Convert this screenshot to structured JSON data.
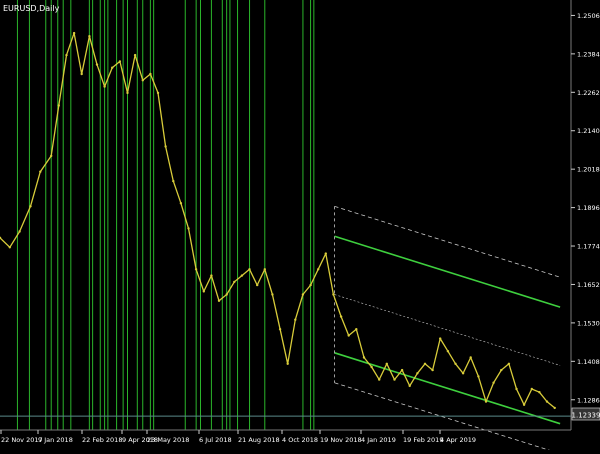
{
  "window": {
    "symbol_label": "EURUSD,Daily",
    "current_price_label": "1.12339"
  },
  "colors": {
    "background": "#000000",
    "axis_text": "#ffffff",
    "price_line": "#d8cc3a",
    "vertical_markers": "#2bb52b",
    "channel_lines": "#3ecf3e",
    "channel_dashed": "#c8c8c8",
    "bid_line": "#5a8a8a"
  },
  "chart_data": {
    "type": "line",
    "title": "EURUSD,Daily",
    "y_ticks": [
      "1.25060",
      "1.23840",
      "1.22620",
      "1.21400",
      "1.20180",
      "1.18960",
      "1.17740",
      "1.16520",
      "1.15300",
      "1.14080",
      "1.12860"
    ],
    "y_tick_values": [
      1.2506,
      1.2384,
      1.2262,
      1.214,
      1.2018,
      1.1896,
      1.1774,
      1.1652,
      1.153,
      1.1408,
      1.1286
    ],
    "ylim": [
      1.119,
      1.2555
    ],
    "x_tick_labels": [
      "22 Nov 2017",
      "9 Jan 2018",
      "22 Feb 2018",
      "9 Apr 2018",
      "23 May 2018",
      "6 Jul 2018",
      "21 Aug 2018",
      "4 Oct 2018",
      "19 Nov 2018",
      "4 Jan 2019",
      "19 Feb 2019",
      "4 Apr 2019"
    ],
    "xlim": [
      "2017-11-22",
      "2019-04-30"
    ],
    "current_price": 1.12339,
    "series": [
      {
        "x": [
          "2017-11-22",
          "2017-12-01",
          "2017-12-10",
          "2017-12-20",
          "2017-12-29",
          "2018-01-08",
          "2018-01-15",
          "2018-01-22",
          "2018-01-29",
          "2018-02-05",
          "2018-02-12",
          "2018-02-19",
          "2018-02-26",
          "2018-03-05",
          "2018-03-12",
          "2018-03-19",
          "2018-03-26",
          "2018-04-02",
          "2018-04-09",
          "2018-04-16",
          "2018-04-23",
          "2018-04-30",
          "2018-05-07",
          "2018-05-14",
          "2018-05-21",
          "2018-05-28",
          "2018-06-04",
          "2018-06-11",
          "2018-06-18",
          "2018-06-25",
          "2018-07-02",
          "2018-07-09",
          "2018-07-16",
          "2018-07-23",
          "2018-07-30",
          "2018-08-06",
          "2018-08-13",
          "2018-08-20",
          "2018-08-27",
          "2018-09-03",
          "2018-09-10",
          "2018-09-17",
          "2018-09-24",
          "2018-10-01",
          "2018-10-08",
          "2018-10-15",
          "2018-10-22",
          "2018-10-29",
          "2018-11-05",
          "2018-11-12",
          "2018-11-19",
          "2018-11-26",
          "2018-12-03",
          "2018-12-10",
          "2018-12-17",
          "2018-12-24",
          "2018-12-31",
          "2019-01-07",
          "2019-01-14",
          "2019-01-21",
          "2019-01-28",
          "2019-02-04",
          "2019-02-11",
          "2019-02-18",
          "2019-02-25",
          "2019-03-04",
          "2019-03-11",
          "2019-03-18",
          "2019-03-25",
          "2019-04-01",
          "2019-04-08",
          "2019-04-15"
        ],
        "y": [
          1.18,
          1.177,
          1.182,
          1.19,
          1.201,
          1.206,
          1.222,
          1.238,
          1.245,
          1.232,
          1.244,
          1.235,
          1.228,
          1.234,
          1.236,
          1.226,
          1.238,
          1.23,
          1.232,
          1.226,
          1.209,
          1.198,
          1.191,
          1.183,
          1.17,
          1.163,
          1.168,
          1.16,
          1.162,
          1.166,
          1.168,
          1.17,
          1.165,
          1.17,
          1.162,
          1.151,
          1.14,
          1.154,
          1.162,
          1.165,
          1.17,
          1.175,
          1.162,
          1.155,
          1.149,
          1.151,
          1.142,
          1.139,
          1.135,
          1.14,
          1.135,
          1.138,
          1.133,
          1.137,
          1.14,
          1.138,
          1.148,
          1.144,
          1.14,
          1.137,
          1.142,
          1.136,
          1.128,
          1.134,
          1.138,
          1.14,
          1.132,
          1.127,
          1.132,
          1.131,
          1.128,
          1.126
        ]
      }
    ],
    "vertical_markers": [
      "2017-12-08",
      "2017-12-19",
      "2018-01-03",
      "2018-01-08",
      "2018-01-14",
      "2018-01-19",
      "2018-01-26",
      "2018-02-12",
      "2018-02-15",
      "2018-02-22",
      "2018-02-26",
      "2018-03-01",
      "2018-03-09",
      "2018-03-15",
      "2018-03-19",
      "2018-03-28",
      "2018-04-02",
      "2018-04-09",
      "2018-04-12",
      "2018-05-11",
      "2018-05-21",
      "2018-05-25",
      "2018-06-04",
      "2018-06-14",
      "2018-06-18",
      "2018-06-21",
      "2018-06-28",
      "2018-07-09",
      "2018-07-23",
      "2018-08-27",
      "2018-09-03",
      "2018-09-06"
    ],
    "regression_channel": {
      "start": "2018-09-25",
      "end": "2019-04-20",
      "center_start": 1.162,
      "center_end": 1.1395,
      "upper_offset": 0.0185,
      "outer_offset": 0.028
    },
    "grid": false
  }
}
